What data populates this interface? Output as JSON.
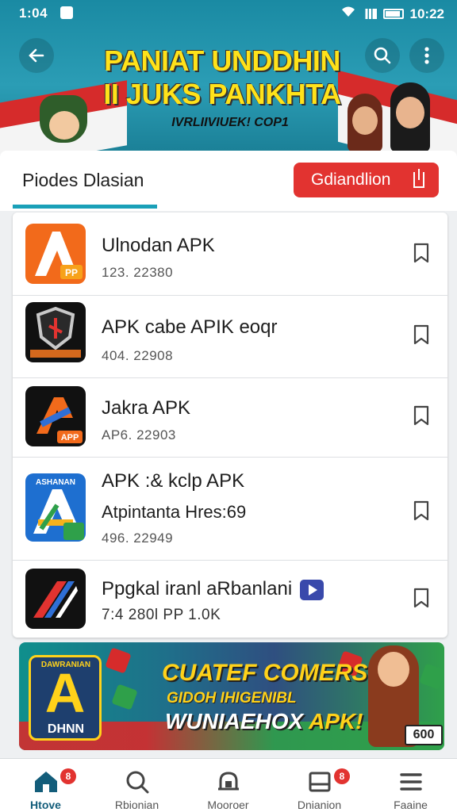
{
  "status_bar": {
    "time": "1:04",
    "clock_right": "10:22"
  },
  "hero": {
    "title_line1": "PANIAT UNDDHIN",
    "title_line2": "II JUKS PANKHTA",
    "subtitle": "IVRLIIVIUEK! COP1"
  },
  "tabs": {
    "active_label": "Piodes Dlasian"
  },
  "download_button": {
    "label": "Gdiandlion"
  },
  "apps": [
    {
      "name": "Ulnodan APK",
      "subtitle": "",
      "meta": "123. 22380",
      "icon": "orange-a-app-icon",
      "icon_color": "#f26a1b"
    },
    {
      "name": "APK cabe APIK eoqr",
      "subtitle": "",
      "meta": "404. 22908",
      "icon": "shield-app-icon",
      "icon_color": "#111111"
    },
    {
      "name": "Jakra APK",
      "subtitle": "",
      "meta": "AP6. 22903",
      "icon": "black-a-app-icon",
      "icon_color": "#111111"
    },
    {
      "name": "APK :& kclp APK",
      "subtitle": "Atpintanta Hres:69",
      "meta": "496. 22949",
      "icon": "blue-a-app-icon",
      "icon_color": "#1e6fd0"
    },
    {
      "name": "Ppgkal iranl aRbanlani",
      "subtitle": "",
      "meta": "7:4 280l PP 1.0K",
      "icon": "red-stripe-app-icon",
      "icon_color": "#111111"
    }
  ],
  "promo": {
    "logo_top": "DAWRANIAN",
    "logo_letter": "A",
    "logo_bottom": "DHNN",
    "line1": "CUATEF COMERSIA!",
    "line2": "GIDOH IHIGENIBL",
    "line3_a": "WUNIAEHOX ",
    "line3_b": "APK!",
    "tag": "600"
  },
  "bottom_nav": [
    {
      "label": "Htove",
      "icon": "home-icon",
      "badge": "8",
      "active": true
    },
    {
      "label": "Rbionian",
      "icon": "search-icon",
      "badge": "",
      "active": false
    },
    {
      "label": "Mooroer",
      "icon": "bell-icon",
      "badge": "",
      "active": false
    },
    {
      "label": "Dnianion",
      "icon": "downloads-icon",
      "badge": "8",
      "active": false
    },
    {
      "label": "Faaine",
      "icon": "menu-icon",
      "badge": "",
      "active": false
    }
  ],
  "colors": {
    "accent_teal": "#1aa0b8",
    "brand_red": "#e23330",
    "title_yellow": "#ffe21a"
  }
}
